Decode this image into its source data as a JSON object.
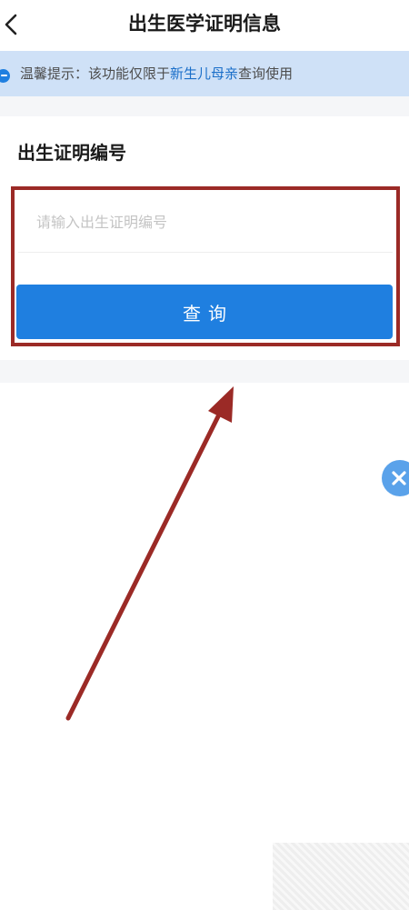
{
  "header": {
    "title": "出生医学证明信息",
    "back_icon": "chevron-left-icon"
  },
  "notice": {
    "icon": "info-icon",
    "prefix": "温馨提示：该功能仅限于",
    "highlight": "新生儿母亲",
    "suffix": "查询使用",
    "highlight_color": "#1b6fc9"
  },
  "form": {
    "section_label": "出生证明编号",
    "input": {
      "value": "",
      "placeholder": "请输入出生证明编号"
    },
    "query_button_label": "查询",
    "button_color": "#1f7fe0"
  },
  "floating": {
    "close_icon": "close-icon"
  },
  "annotation": {
    "highlight_color": "#9b2a26",
    "arrow_icon": "arrow-icon"
  }
}
